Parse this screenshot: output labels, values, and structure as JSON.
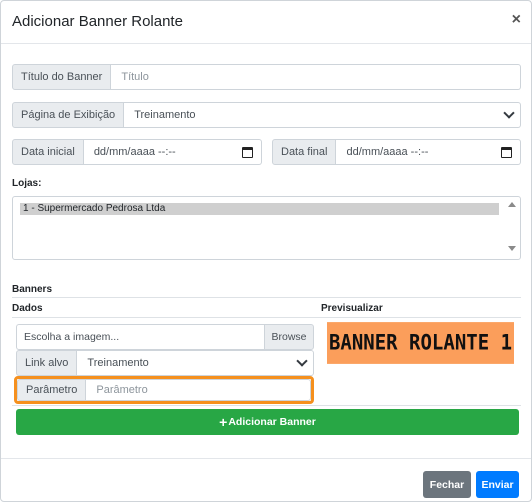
{
  "modal": {
    "title": "Adicionar Banner Rolante",
    "close_symbol": "×"
  },
  "form": {
    "titulo": {
      "label": "Título do Banner",
      "placeholder": "Título"
    },
    "pagina": {
      "label": "Página de Exibição",
      "value": "Treinamento"
    },
    "data_inicial": {
      "label": "Data inicial",
      "value": "dd/mm/aaaa --:--"
    },
    "data_final": {
      "label": "Data final",
      "value": "dd/mm/aaaa --:--"
    },
    "lojas": {
      "label": "Lojas:",
      "options": [
        "1 - Supermercado Pedrosa Ltda"
      ]
    }
  },
  "banners": {
    "heading": "Banners",
    "col_dados": "Dados",
    "col_preview": "Previsualizar",
    "file": {
      "placeholder": "Escolha a imagem...",
      "browse_label": "Browse"
    },
    "link_alvo": {
      "label": "Link alvo",
      "value": "Treinamento"
    },
    "parametro": {
      "label": "Parâmetro",
      "placeholder": "Parâmetro"
    },
    "preview_text": "BANNER ROLANTE 1",
    "add_label": "Adicionar Banner"
  },
  "footer": {
    "close_label": "Fechar",
    "send_label": "Enviar"
  },
  "colors": {
    "highlight": "#f5901e",
    "preview_bg": "#fb9e5b",
    "add_button": "#28a745",
    "close_button": "#6c757d",
    "send_button": "#007bff"
  }
}
